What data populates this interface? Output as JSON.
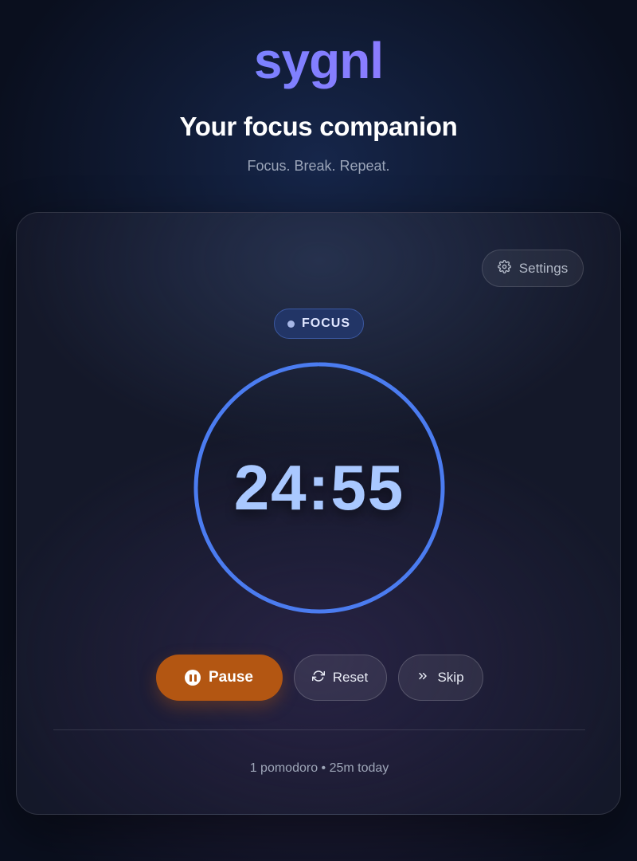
{
  "brand": {
    "logo": "sygnl"
  },
  "hero": {
    "headline": "Your focus companion",
    "tagline": "Focus. Break. Repeat."
  },
  "card": {
    "settings_label": "Settings",
    "settings_icon": "gear-icon",
    "mode_label": "FOCUS",
    "timer": {
      "display": "24:55",
      "progress": 0.997
    },
    "controls": {
      "pause_label": "Pause",
      "pause_icon": "pause-icon",
      "reset_label": "Reset",
      "reset_icon": "refresh-icon",
      "skip_label": "Skip",
      "skip_icon": "double-chevron-right-icon"
    },
    "stats": "1 pomodoro • 25m today"
  },
  "colors": {
    "accent": "#4b7cf0",
    "timer_text": "#a9c8ff",
    "pause_button": "#b35612",
    "focus_pill": "#223566"
  }
}
